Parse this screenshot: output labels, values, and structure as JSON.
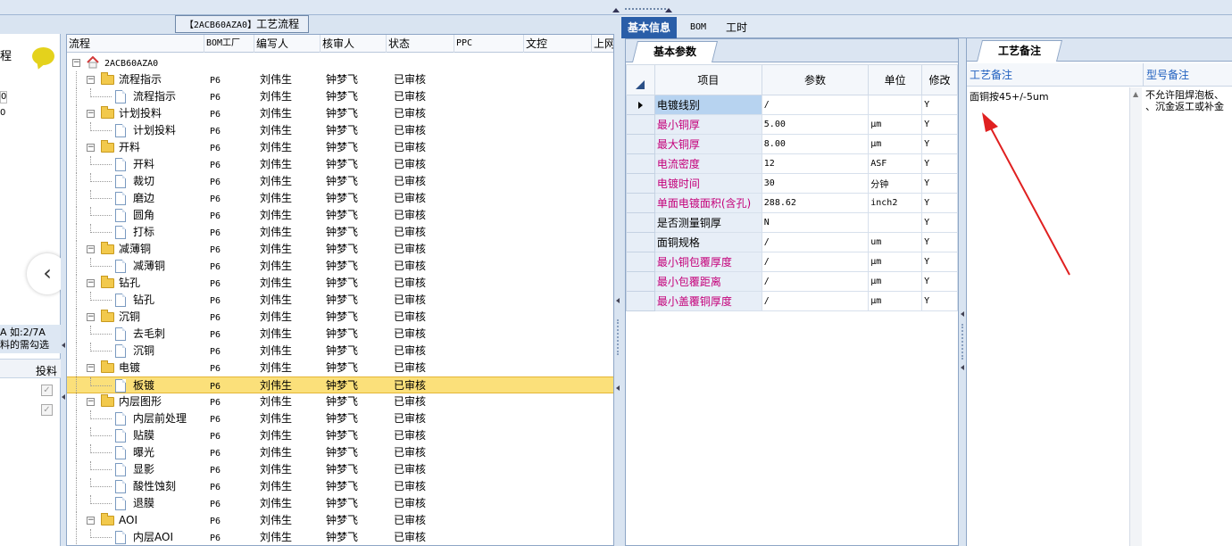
{
  "left_stub": {
    "title": "程",
    "zeros": [
      "0",
      "0"
    ],
    "hint_line1": "A 如:2/7A",
    "hint_line2": "料的需勾选",
    "column": "投料"
  },
  "process": {
    "title_code": "【2ACB60AZA0】",
    "title_text": "工艺流程",
    "columns": [
      "流程",
      "BOM工厂",
      "编写人",
      "核审人",
      "状态",
      "PPC",
      "文控",
      "上网"
    ],
    "root": "2ACB60AZA0",
    "rows": [
      {
        "name": "流程指示",
        "level": 1,
        "type": "folder",
        "factory": "P6",
        "writer": "刘伟生",
        "reviewer": "钟梦飞",
        "status": "已审核"
      },
      {
        "name": "流程指示",
        "level": 2,
        "type": "doc",
        "factory": "P6",
        "writer": "刘伟生",
        "reviewer": "钟梦飞",
        "status": "已审核"
      },
      {
        "name": "计划投料",
        "level": 1,
        "type": "folder",
        "factory": "P6",
        "writer": "刘伟生",
        "reviewer": "钟梦飞",
        "status": "已审核"
      },
      {
        "name": "计划投料",
        "level": 2,
        "type": "doc",
        "factory": "P6",
        "writer": "刘伟生",
        "reviewer": "钟梦飞",
        "status": "已审核"
      },
      {
        "name": "开料",
        "level": 1,
        "type": "folder",
        "factory": "P6",
        "writer": "刘伟生",
        "reviewer": "钟梦飞",
        "status": "已审核"
      },
      {
        "name": "开料",
        "level": 2,
        "type": "doc",
        "factory": "P6",
        "writer": "刘伟生",
        "reviewer": "钟梦飞",
        "status": "已审核"
      },
      {
        "name": "裁切",
        "level": 2,
        "type": "doc",
        "factory": "P6",
        "writer": "刘伟生",
        "reviewer": "钟梦飞",
        "status": "已审核"
      },
      {
        "name": "磨边",
        "level": 2,
        "type": "doc",
        "factory": "P6",
        "writer": "刘伟生",
        "reviewer": "钟梦飞",
        "status": "已审核"
      },
      {
        "name": "圆角",
        "level": 2,
        "type": "doc",
        "factory": "P6",
        "writer": "刘伟生",
        "reviewer": "钟梦飞",
        "status": "已审核"
      },
      {
        "name": "打标",
        "level": 2,
        "type": "doc",
        "factory": "P6",
        "writer": "刘伟生",
        "reviewer": "钟梦飞",
        "status": "已审核"
      },
      {
        "name": "减薄铜",
        "level": 1,
        "type": "folder",
        "factory": "P6",
        "writer": "刘伟生",
        "reviewer": "钟梦飞",
        "status": "已审核"
      },
      {
        "name": "减薄铜",
        "level": 2,
        "type": "doc",
        "factory": "P6",
        "writer": "刘伟生",
        "reviewer": "钟梦飞",
        "status": "已审核"
      },
      {
        "name": "钻孔",
        "level": 1,
        "type": "folder",
        "factory": "P6",
        "writer": "刘伟生",
        "reviewer": "钟梦飞",
        "status": "已审核"
      },
      {
        "name": "钻孔",
        "level": 2,
        "type": "doc",
        "factory": "P6",
        "writer": "刘伟生",
        "reviewer": "钟梦飞",
        "status": "已审核"
      },
      {
        "name": "沉铜",
        "level": 1,
        "type": "folder",
        "factory": "P6",
        "writer": "刘伟生",
        "reviewer": "钟梦飞",
        "status": "已审核"
      },
      {
        "name": "去毛刺",
        "level": 2,
        "type": "doc",
        "factory": "P6",
        "writer": "刘伟生",
        "reviewer": "钟梦飞",
        "status": "已审核"
      },
      {
        "name": "沉铜",
        "level": 2,
        "type": "doc",
        "factory": "P6",
        "writer": "刘伟生",
        "reviewer": "钟梦飞",
        "status": "已审核"
      },
      {
        "name": "电镀",
        "level": 1,
        "type": "folder",
        "factory": "P6",
        "writer": "刘伟生",
        "reviewer": "钟梦飞",
        "status": "已审核"
      },
      {
        "name": "板镀",
        "level": 2,
        "type": "doc",
        "factory": "P6",
        "writer": "刘伟生",
        "reviewer": "钟梦飞",
        "status": "已审核",
        "selected": true
      },
      {
        "name": "内层图形",
        "level": 1,
        "type": "folder",
        "factory": "P6",
        "writer": "刘伟生",
        "reviewer": "钟梦飞",
        "status": "已审核"
      },
      {
        "name": "内层前处理",
        "level": 2,
        "type": "doc",
        "factory": "P6",
        "writer": "刘伟生",
        "reviewer": "钟梦飞",
        "status": "已审核"
      },
      {
        "name": "贴膜",
        "level": 2,
        "type": "doc",
        "factory": "P6",
        "writer": "刘伟生",
        "reviewer": "钟梦飞",
        "status": "已审核"
      },
      {
        "name": "曝光",
        "level": 2,
        "type": "doc",
        "factory": "P6",
        "writer": "刘伟生",
        "reviewer": "钟梦飞",
        "status": "已审核"
      },
      {
        "name": "显影",
        "level": 2,
        "type": "doc",
        "factory": "P6",
        "writer": "刘伟生",
        "reviewer": "钟梦飞",
        "status": "已审核"
      },
      {
        "name": "酸性蚀刻",
        "level": 2,
        "type": "doc",
        "factory": "P6",
        "writer": "刘伟生",
        "reviewer": "钟梦飞",
        "status": "已审核"
      },
      {
        "name": "退膜",
        "level": 2,
        "type": "doc",
        "factory": "P6",
        "writer": "刘伟生",
        "reviewer": "钟梦飞",
        "status": "已审核"
      },
      {
        "name": "AOI",
        "level": 1,
        "type": "folder",
        "factory": "P6",
        "writer": "刘伟生",
        "reviewer": "钟梦飞",
        "status": "已审核"
      },
      {
        "name": "内层AOI",
        "level": 2,
        "type": "doc",
        "factory": "P6",
        "writer": "刘伟生",
        "reviewer": "钟梦飞",
        "status": "已审核"
      }
    ]
  },
  "right_tabs": [
    "基本信息",
    "BOM",
    "工时"
  ],
  "basic": {
    "tab": "基本参数",
    "columns": [
      "项目",
      "参数",
      "单位",
      "修改"
    ],
    "rows": [
      {
        "item": "电镀线别",
        "value": "/",
        "unit": "",
        "flag": "Y",
        "red": false,
        "current": true
      },
      {
        "item": "最小铜厚",
        "value": "5.00",
        "unit": "μm",
        "flag": "Y",
        "red": true
      },
      {
        "item": "最大铜厚",
        "value": "8.00",
        "unit": "μm",
        "flag": "Y",
        "red": true
      },
      {
        "item": "电流密度",
        "value": "12",
        "unit": "ASF",
        "flag": "Y",
        "red": true
      },
      {
        "item": "电镀时间",
        "value": "30",
        "unit": "分钟",
        "flag": "Y",
        "red": true
      },
      {
        "item": "单面电镀面积(含孔)",
        "value": "288.62",
        "unit": "inch2",
        "flag": "Y",
        "red": true
      },
      {
        "item": "是否测量铜厚",
        "value": "N",
        "unit": "",
        "flag": "Y",
        "red": false
      },
      {
        "item": "面铜规格",
        "value": "/",
        "unit": "um",
        "flag": "Y",
        "red": false
      },
      {
        "item": "最小铜包覆厚度",
        "value": "/",
        "unit": "μm",
        "flag": "Y",
        "red": true
      },
      {
        "item": "最小包覆距离",
        "value": "/",
        "unit": "μm",
        "flag": "Y",
        "red": true
      },
      {
        "item": "最小盖覆铜厚度",
        "value": "/",
        "unit": "μm",
        "flag": "Y",
        "red": true
      }
    ]
  },
  "notes": {
    "tab": "工艺备注",
    "columns": [
      "工艺备注",
      "型号备注"
    ],
    "process_note": "面铜按45+/-5um",
    "model_note_line1": "不允许阻焊泡板、",
    "model_note_line2": "、沉金返工或补金"
  },
  "colors": {
    "accent": "#2a5ea8",
    "selected_row": "#fbe07a",
    "required_param": "#c4007a",
    "annotation_arrow": "#e02020"
  }
}
